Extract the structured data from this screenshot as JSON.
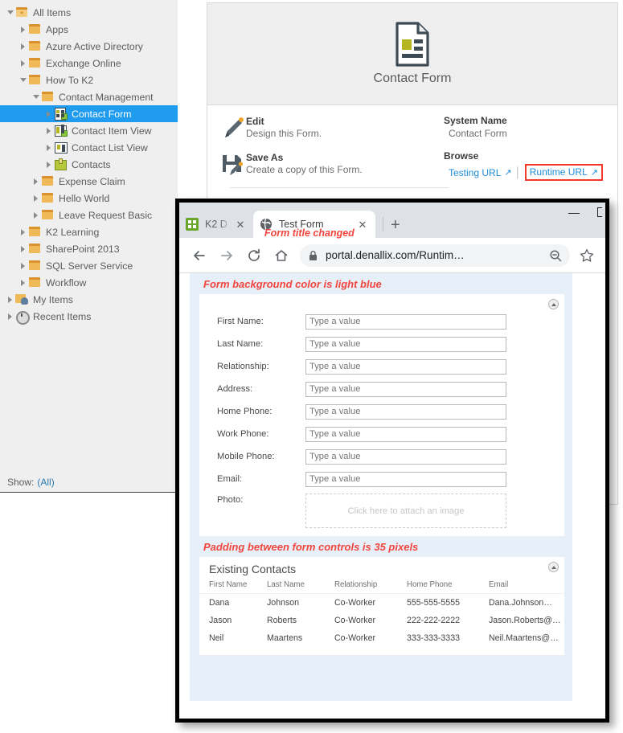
{
  "tree": {
    "items": [
      {
        "label": "All Items",
        "icon": "folder-star-icon",
        "indent": 0,
        "twisty": "down",
        "selected": false
      },
      {
        "label": "Apps",
        "icon": "folder-icon",
        "indent": 1,
        "twisty": "right",
        "selected": false
      },
      {
        "label": "Azure Active Directory",
        "icon": "folder-icon",
        "indent": 1,
        "twisty": "right",
        "selected": false
      },
      {
        "label": "Exchange Online",
        "icon": "folder-icon",
        "indent": 1,
        "twisty": "right",
        "selected": false
      },
      {
        "label": "How To K2",
        "icon": "folder-icon",
        "indent": 1,
        "twisty": "down",
        "selected": false
      },
      {
        "label": "Contact Management",
        "icon": "folder-icon",
        "indent": 2,
        "twisty": "down",
        "selected": false
      },
      {
        "label": "Contact Form",
        "icon": "form-icon",
        "indent": 3,
        "twisty": "right",
        "selected": true
      },
      {
        "label": "Contact Item View",
        "icon": "item-view-icon",
        "indent": 3,
        "twisty": "right",
        "selected": false
      },
      {
        "label": "Contact List View",
        "icon": "list-view-icon",
        "indent": 3,
        "twisty": "right",
        "selected": false
      },
      {
        "label": "Contacts",
        "icon": "smartobject-cube-icon",
        "indent": 3,
        "twisty": "right",
        "selected": false
      },
      {
        "label": "Expense Claim",
        "icon": "folder-icon",
        "indent": 2,
        "twisty": "right",
        "selected": false
      },
      {
        "label": "Hello World",
        "icon": "folder-icon",
        "indent": 2,
        "twisty": "right",
        "selected": false
      },
      {
        "label": "Leave Request Basic",
        "icon": "folder-icon",
        "indent": 2,
        "twisty": "right",
        "selected": false
      },
      {
        "label": "K2 Learning",
        "icon": "folder-icon",
        "indent": 1,
        "twisty": "right",
        "selected": false
      },
      {
        "label": "SharePoint 2013",
        "icon": "folder-icon",
        "indent": 1,
        "twisty": "right",
        "selected": false
      },
      {
        "label": "SQL Server Service",
        "icon": "folder-icon",
        "indent": 1,
        "twisty": "right",
        "selected": false
      },
      {
        "label": "Workflow",
        "icon": "folder-icon",
        "indent": 1,
        "twisty": "right",
        "selected": false
      },
      {
        "label": "My Items",
        "icon": "folder-user-icon",
        "indent": 0,
        "twisty": "right",
        "selected": false
      },
      {
        "label": "Recent Items",
        "icon": "clock-icon",
        "indent": 0,
        "twisty": "right",
        "selected": false
      }
    ],
    "show_label": "Show:",
    "show_value": "(All)"
  },
  "detail": {
    "hero_title": "Contact Form",
    "hero_icon": "form-document-icon",
    "actions": [
      {
        "title": "Edit",
        "subtitle": "Design this Form.",
        "icon": "pencil-icon"
      },
      {
        "title": "Save As",
        "subtitle": "Create a copy of this Form.",
        "icon": "save-as-icon"
      }
    ],
    "system_name_label": "System Name",
    "system_name_value": "Contact Form",
    "browse_label": "Browse",
    "testing_url_label": "Testing URL",
    "runtime_url_label": "Runtime URL",
    "external_link_icon": "external-link-icon",
    "highlight_color": "#f2392c"
  },
  "browser": {
    "tabs": [
      {
        "title": "K2 D",
        "favicon": "k2-designer-icon",
        "active": false,
        "close_icon": "close-icon"
      },
      {
        "title": "Test Form",
        "favicon": "globe-icon",
        "active": true,
        "close_icon": "close-icon"
      }
    ],
    "new_tab_label": "+",
    "minimize_label": "—",
    "nav": {
      "back_icon": "back-arrow-icon",
      "forward_icon": "forward-arrow-icon",
      "reload_icon": "reload-icon",
      "home_icon": "home-icon"
    },
    "omnibox": {
      "lock_icon": "lock-icon",
      "url": "portal.denallix.com/Runtim…",
      "zoom_icon": "zoom-out-icon",
      "star_icon": "star-icon"
    }
  },
  "annotations": {
    "tab_note": "Form title changed",
    "bg_note": "Form background color is light blue",
    "padding_note": "Padding between form controls is 35 pixels"
  },
  "form": {
    "collapse_icon": "collapse-up-icon",
    "fields": [
      {
        "label": "First Name:",
        "placeholder": "Type a value",
        "value": ""
      },
      {
        "label": "Last Name:",
        "placeholder": "Type a value",
        "value": ""
      },
      {
        "label": "Relationship:",
        "placeholder": "Type a value",
        "value": ""
      },
      {
        "label": "Address:",
        "placeholder": "Type a value",
        "value": ""
      },
      {
        "label": "Home Phone:",
        "placeholder": "Type a value",
        "value": ""
      },
      {
        "label": "Work Phone:",
        "placeholder": "Type a value",
        "value": ""
      },
      {
        "label": "Mobile Phone:",
        "placeholder": "Type a value",
        "value": ""
      },
      {
        "label": "Email:",
        "placeholder": "Type a value",
        "value": ""
      }
    ],
    "photo_label": "Photo:",
    "photo_placeholder": "Click here to attach an image"
  },
  "contacts_list": {
    "title": "Existing Contacts",
    "collapse_icon": "collapse-up-icon",
    "columns": [
      "First Name",
      "Last Name",
      "Relationship",
      "Home Phone",
      "Email"
    ],
    "rows": [
      [
        "Dana",
        "Johnson",
        "Co-Worker",
        "555-555-5555",
        "Dana.Johnson…"
      ],
      [
        "Jason",
        "Roberts",
        "Co-Worker",
        "222-222-2222",
        "Jason.Roberts@…"
      ],
      [
        "Neil",
        "Maartens",
        "Co-Worker",
        "333-333-3333",
        "Neil.Maartens@…"
      ]
    ]
  }
}
